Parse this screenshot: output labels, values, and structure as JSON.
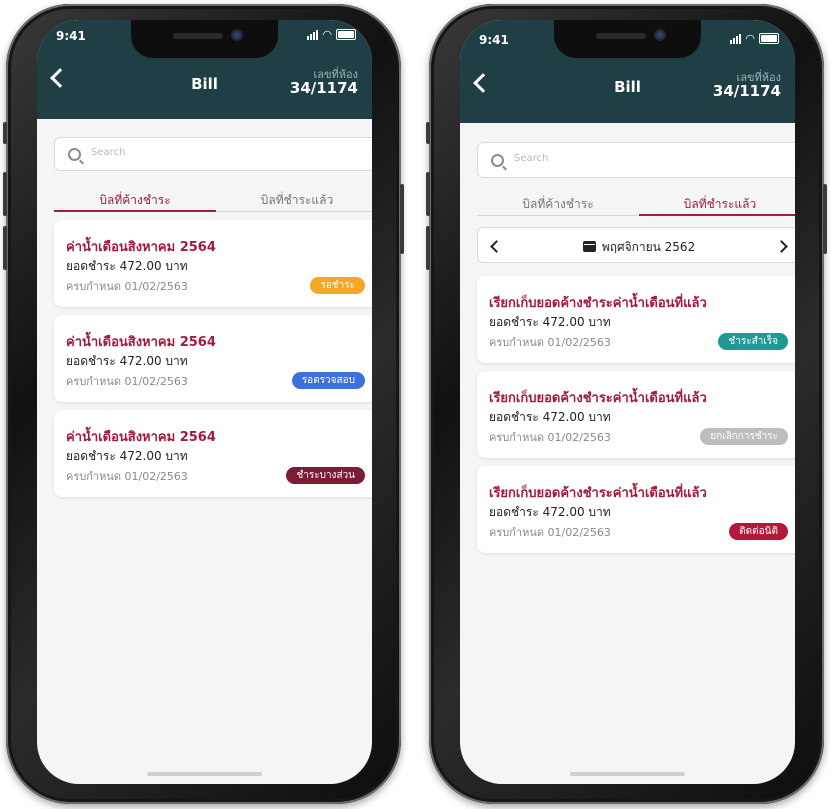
{
  "status_bar": {
    "time": "9:41"
  },
  "header": {
    "back": "back",
    "title": "Bill",
    "room_label": "เลขที่ห้อง",
    "room_value": "34/1174"
  },
  "search": {
    "placeholder": "Search"
  },
  "tabs": [
    "บิลที่ค้างชำระ",
    "บิลที่ชำระแล้ว"
  ],
  "colors": {
    "header_bg": "#1f3f45",
    "accent": "#a31b3c",
    "badge_waiting": "#f5a623",
    "badge_checking": "#3f6fd8",
    "badge_partial": "#7c1c35",
    "badge_success": "#1e9a94",
    "badge_cancelled": "#bdbdbd",
    "badge_contact": "#b3193a"
  },
  "left_screen": {
    "active_tab": 0,
    "bills": [
      {
        "title": "ค่าน้ำเดือนสิงหาคม 2564",
        "amount": "ยอดชำระ 472.00 บาท",
        "due": "ครบกำหนด 01/02/2563",
        "status": "รอชำระ"
      },
      {
        "title": "ค่าน้ำเดือนสิงหาคม 2564",
        "amount": "ยอดชำระ 472.00 บาท",
        "due": "ครบกำหนด 01/02/2563",
        "status": "รอตรวจสอบ"
      },
      {
        "title": "ค่าน้ำเดือนสิงหาคม 2564",
        "amount": "ยอดชำระ 472.00 บาท",
        "due": "ครบกำหนด 01/02/2563",
        "status": "ชำระบางส่วน"
      }
    ]
  },
  "right_screen": {
    "active_tab": 1,
    "month": "พฤศจิกายน 2562",
    "bills": [
      {
        "title": "เรียกเก็บยอดค้างชำระค่าน้ำเดือนที่แล้ว",
        "amount": "ยอดชำระ 472.00 บาท",
        "due": "ครบกำหนด 01/02/2563",
        "status": "ชำระสำเร็จ"
      },
      {
        "title": "เรียกเก็บยอดค้างชำระค่าน้ำเดือนที่แล้ว",
        "amount": "ยอดชำระ 472.00 บาท",
        "due": "ครบกำหนด 01/02/2563",
        "status": "ยกเลิกการชำระ"
      },
      {
        "title": "เรียกเก็บยอดค้างชำระค่าน้ำเดือนที่แล้ว",
        "amount": "ยอดชำระ 472.00 บาท",
        "due": "ครบกำหนด 01/02/2563",
        "status": "ติดต่อนิติ"
      }
    ]
  }
}
